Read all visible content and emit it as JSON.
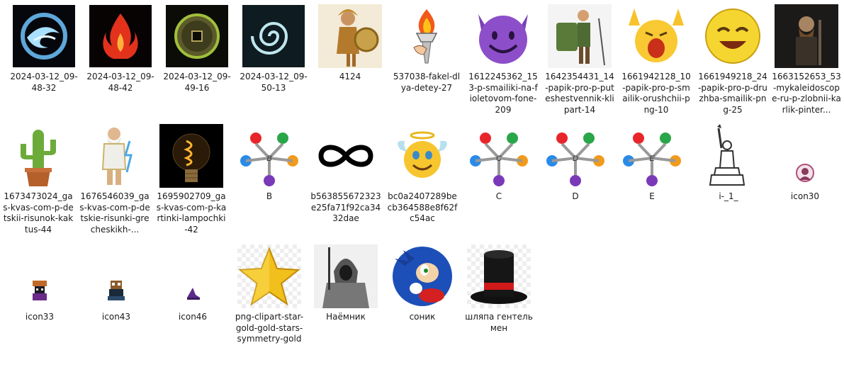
{
  "files": [
    {
      "name": "2024-03-12_09-48-32",
      "icon": "water-element-swirl-icon"
    },
    {
      "name": "2024-03-12_09-48-42",
      "icon": "fire-element-flame-icon"
    },
    {
      "name": "2024-03-12_09-49-16",
      "icon": "earth-element-coin-icon"
    },
    {
      "name": "2024-03-12_09-50-13",
      "icon": "air-element-swirl-icon"
    },
    {
      "name": "4124",
      "icon": "armored-goddess-icon"
    },
    {
      "name": "537038-fakel-dlya-detey-27",
      "icon": "torch-icon"
    },
    {
      "name": "1612245362_153-p-smailiki-na-fioletovom-fone-209",
      "icon": "purple-devil-emoji-icon"
    },
    {
      "name": "1642354431_14-papik-pro-p-puteshestvennik-klipart-14",
      "icon": "hiker-backpack-icon"
    },
    {
      "name": "1661942128_10-papik-pro-p-smailik-orushchii-png-10",
      "icon": "screaming-smiley-icon"
    },
    {
      "name": "1661949218_24-papik-pro-p-druzhba-smailik-png-25",
      "icon": "happy-smiley-icon"
    },
    {
      "name": "1663152653_53-mykaleidoscope-ru-p-zlobnii-karlik-pinter...",
      "icon": "dwarf-warrior-icon"
    },
    {
      "name": "1673473024_gas-kvas-com-p-detskii-risunok-kaktus-44",
      "icon": "cactus-pot-icon"
    },
    {
      "name": "1676546039_gas-kvas-com-p-detskie-risunki-grecheskikh-...",
      "icon": "zeus-god-icon"
    },
    {
      "name": "1695902709_gas-kvas-com-p-kartinki-lampochki-42",
      "icon": "light-bulb-icon"
    },
    {
      "name": "B",
      "icon": "people-circle-b-icon",
      "letter": "B"
    },
    {
      "name": "b563855672323e25fa71f92ca3432dae",
      "icon": "infinity-icon"
    },
    {
      "name": "bc0a2407289becb364588e8f62fc54ac",
      "icon": "angel-smiley-icon"
    },
    {
      "name": "C",
      "icon": "people-circle-c-icon",
      "letter": "C"
    },
    {
      "name": "D",
      "icon": "people-circle-d-icon",
      "letter": "D"
    },
    {
      "name": "E",
      "icon": "people-circle-e-icon",
      "letter": "E"
    },
    {
      "name": "i-_1_",
      "icon": "statue-of-liberty-icon"
    },
    {
      "name": "icon30",
      "icon": "small-avatar-icon"
    },
    {
      "name": "icon33",
      "icon": "pixel-character-icon"
    },
    {
      "name": "icon43",
      "icon": "pixel-owl-icon"
    },
    {
      "name": "icon46",
      "icon": "pixel-hat-icon"
    },
    {
      "name": "png-clipart-star-gold-gold-stars-symmetry-gold",
      "icon": "gold-star-icon"
    },
    {
      "name": "Наёмник",
      "icon": "hooded-knight-icon"
    },
    {
      "name": "соник",
      "icon": "sonic-hedgehog-icon"
    },
    {
      "name": "шляпа гентельмен",
      "icon": "top-hat-icon"
    }
  ]
}
